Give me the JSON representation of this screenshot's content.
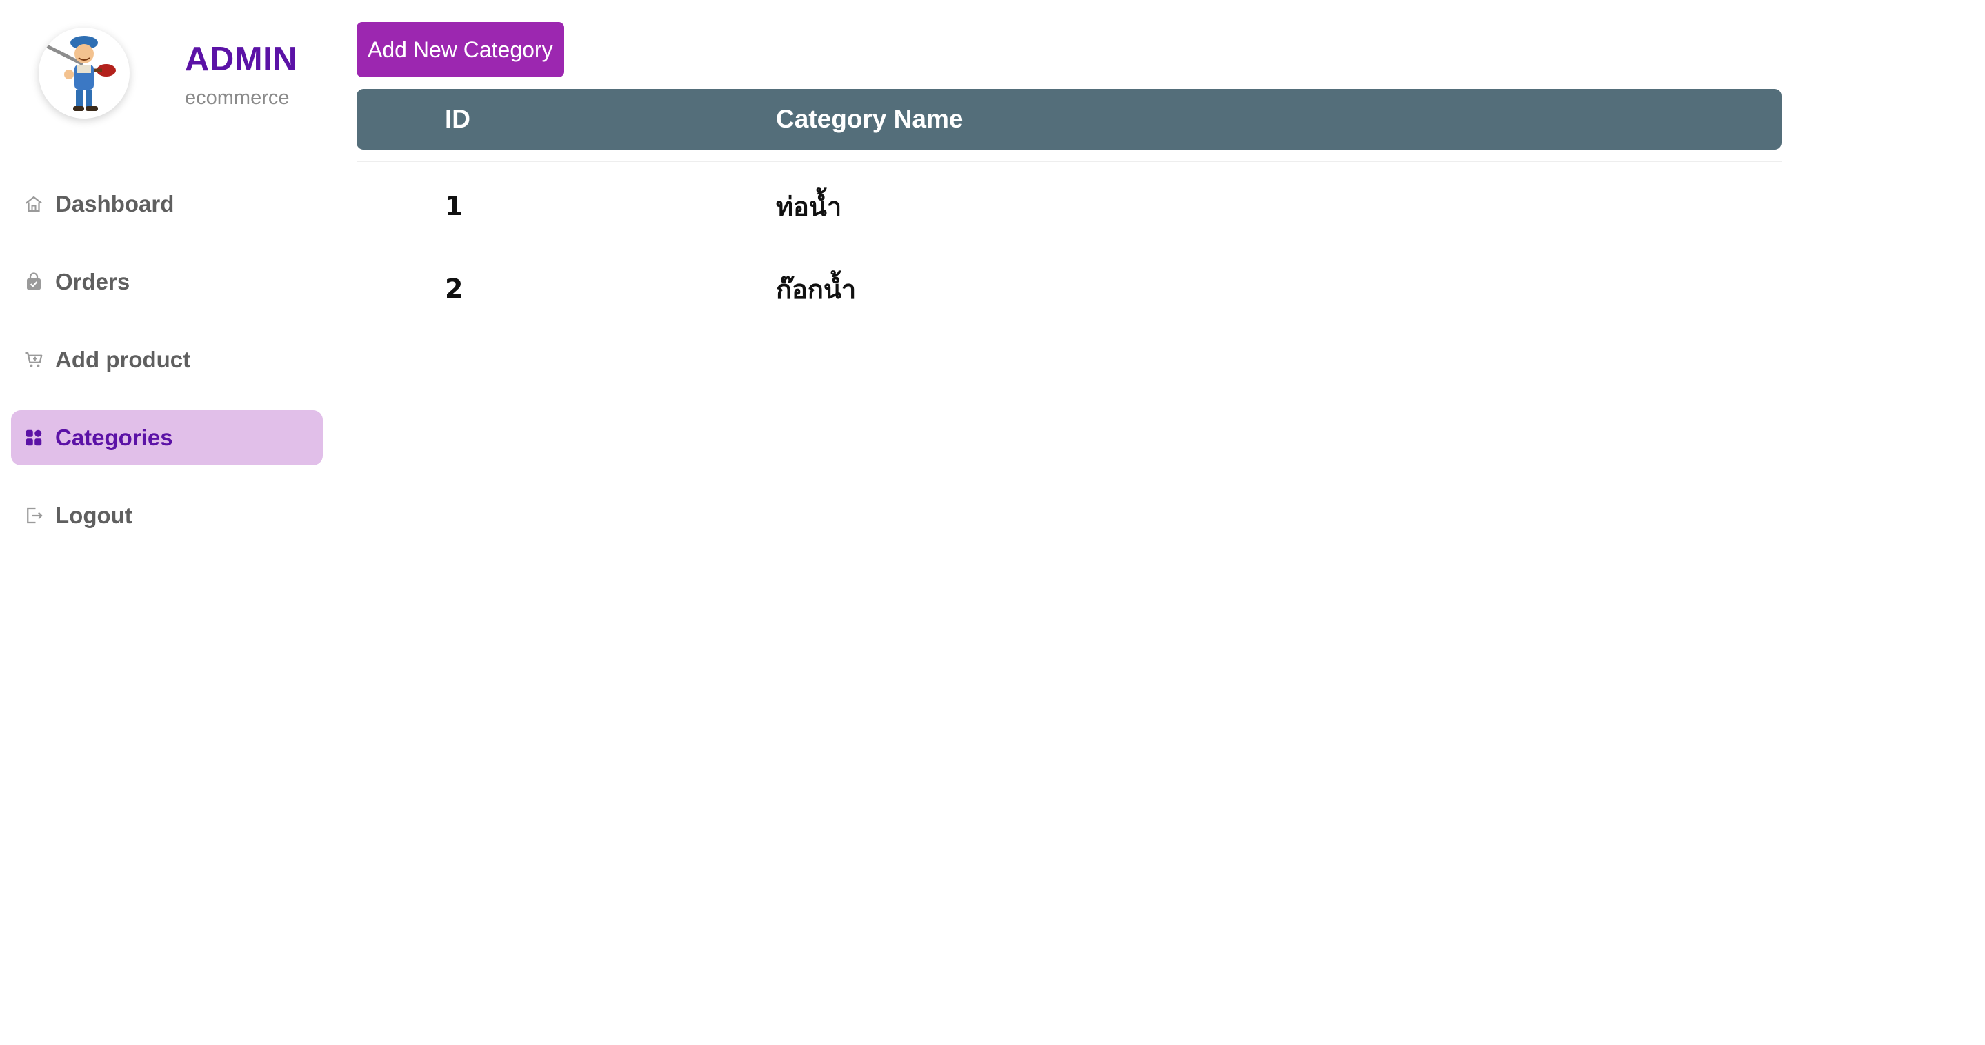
{
  "brand": {
    "title": "ADMIN",
    "subtitle": "ecommerce",
    "avatar_icon": "plumber-mascot-icon"
  },
  "sidebar": {
    "items": [
      {
        "label": "Dashboard",
        "icon": "home-icon",
        "active": false
      },
      {
        "label": "Orders",
        "icon": "shopping-bag-icon",
        "active": false
      },
      {
        "label": "Add product",
        "icon": "cart-plus-icon",
        "active": false
      },
      {
        "label": "Categories",
        "icon": "grid-icon",
        "active": true
      },
      {
        "label": "Logout",
        "icon": "logout-icon",
        "active": false
      }
    ]
  },
  "main": {
    "add_button_label": "Add New Category",
    "table": {
      "headers": {
        "id": "ID",
        "name": "Category Name"
      },
      "rows": [
        {
          "id": "1",
          "name": "ท่อน้ำ"
        },
        {
          "id": "2",
          "name": "ก๊อกน้ำ"
        }
      ]
    }
  },
  "colors": {
    "brand_purple": "#5b12a6",
    "button_purple": "#9c27b0",
    "active_bg": "#e1bfe9",
    "table_header": "#546e7a"
  }
}
